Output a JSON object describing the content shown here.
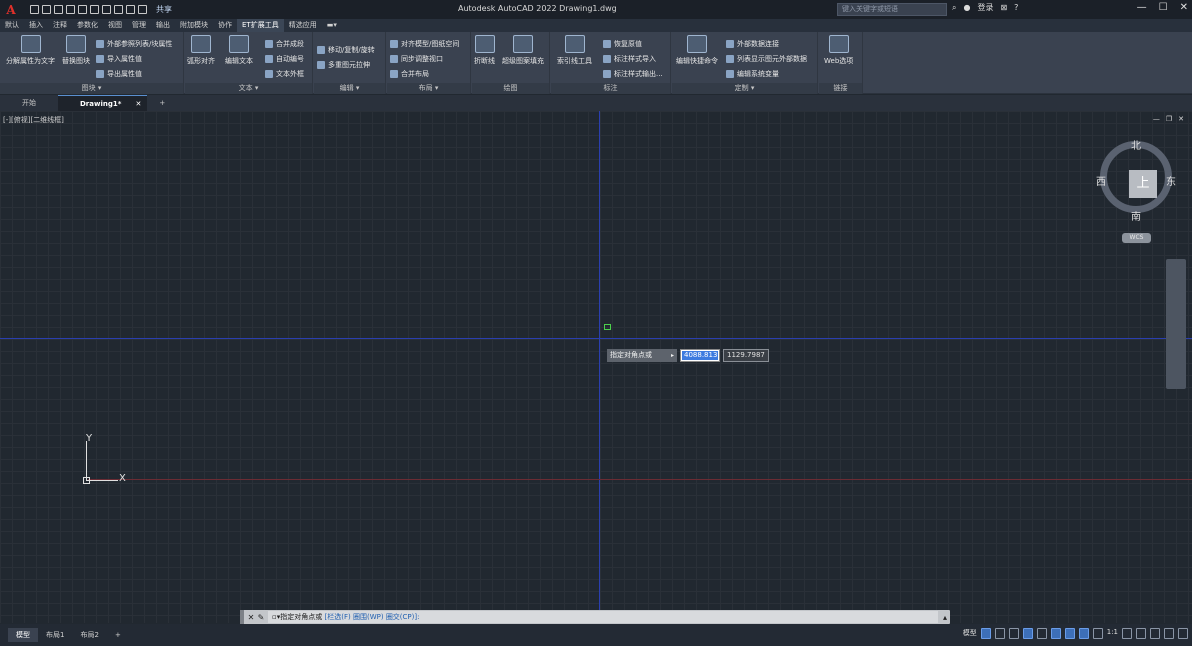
{
  "app": {
    "logo": "A",
    "title": "Autodesk AutoCAD 2022   Drawing1.dwg",
    "share": "共享",
    "search_placeholder": "键入关键字或短语",
    "login": "登录"
  },
  "ribbon_tabs": [
    "默认",
    "插入",
    "注释",
    "参数化",
    "视图",
    "管理",
    "输出",
    "附加模块",
    "协作",
    "ET扩展工具",
    "精选应用"
  ],
  "active_ribbon_tab": "ET扩展工具",
  "panels": {
    "block": {
      "title": "图块 ▾",
      "big1": "分解属性为文字",
      "big2": "替换图块",
      "s1": "外部参照列表/块属性",
      "s2": "导入属性值",
      "s3": "导出属性值"
    },
    "text": {
      "title": "文本 ▾",
      "big1": "弧形对齐",
      "big2": "编辑文本",
      "s1": "合并成段",
      "s2": "自动编号",
      "s3": "文本外框"
    },
    "edit": {
      "title": "编辑 ▾",
      "s1": "移动/复制/旋转",
      "s2": "多重图元拉伸"
    },
    "layout": {
      "title": "布局 ▾",
      "s1": "对齐模型/图纸空间",
      "s2": "同步调整视口",
      "s3": "合并布局"
    },
    "draw": {
      "title": "绘图",
      "big1": "折断线",
      "big2": "超级图案填充"
    },
    "dim": {
      "title": "标注",
      "big1": "索引线工具",
      "s1": "恢复原值",
      "s2": "标注样式导入",
      "s3": "标注样式输出..."
    },
    "custom": {
      "title": "定制 ▾",
      "big1": "编辑快捷命令",
      "s1": "外部数据连接",
      "s2": "列表显示图元外部数据",
      "s3": "编辑系统变量"
    },
    "link": {
      "title": "链接",
      "big1": "Web选项"
    }
  },
  "doc_tabs": {
    "start": "开始",
    "drawing": "Drawing1*",
    "close": "✕",
    "add": "+"
  },
  "viewport": {
    "label": "[-][俯视][二维线框]"
  },
  "viewcube": {
    "north": "北",
    "south": "南",
    "east": "东",
    "west": "西",
    "top": "上",
    "wcs": "WCS"
  },
  "ucs": {
    "x": "X",
    "y": "Y"
  },
  "dynamic_input": {
    "prompt": "指定对角点或",
    "value_x": "4088.813",
    "value_y": "1129.7987"
  },
  "command_line": {
    "prompt": "▫▾指定对角点或",
    "opt1": "[栏选(F)",
    "opt2": "圈围(WP)",
    "opt3": "圈交(CP)]:"
  },
  "layout_tabs": [
    "模型",
    "布局1",
    "布局2",
    "+"
  ],
  "status": {
    "model": "模型",
    "scale": "1:1"
  }
}
